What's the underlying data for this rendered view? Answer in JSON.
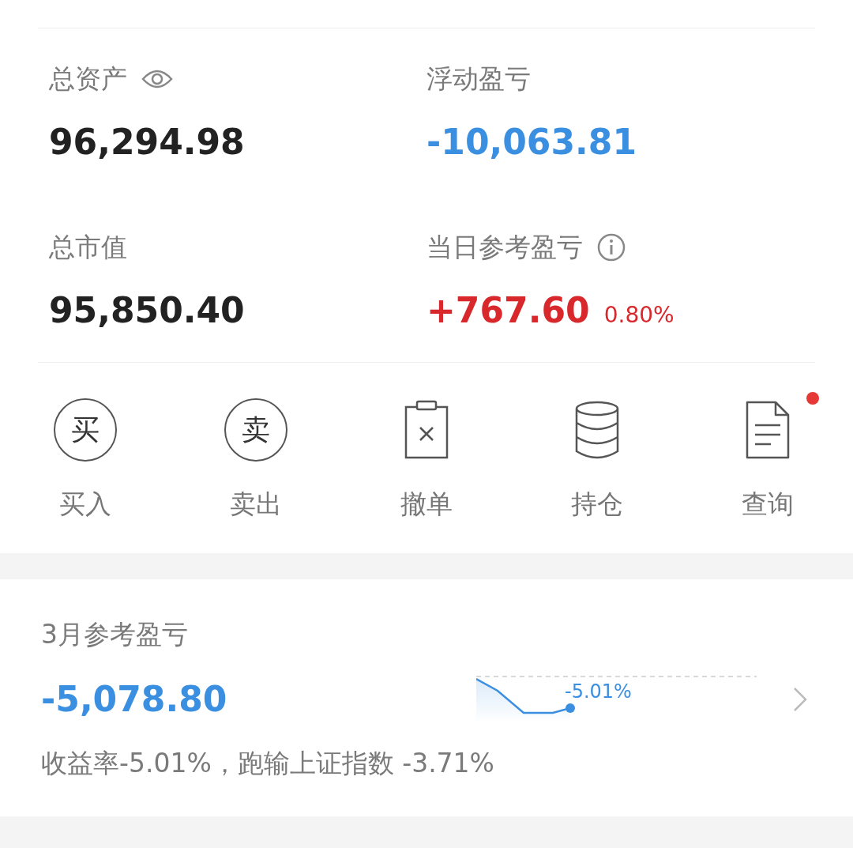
{
  "summary": [
    {
      "label": "总资产",
      "value": "96,294.98",
      "color": "#222222"
    },
    {
      "label": "浮动盈亏",
      "value": "-10,063.81",
      "color": "#3b8fe0"
    },
    {
      "label": "总市值",
      "value": "95,850.40",
      "color": "#222222"
    },
    {
      "label": "当日参考盈亏",
      "value": "+767.60",
      "color": "#d8282c",
      "percent": "0.80%"
    }
  ],
  "actions": [
    {
      "label": "买入",
      "kind": "circle-char",
      "icon_text": "买",
      "badge": false
    },
    {
      "label": "卖出",
      "kind": "circle-char",
      "icon_text": "卖",
      "badge": false
    },
    {
      "label": "撤单",
      "kind": "clipboard",
      "badge": false
    },
    {
      "label": "持仓",
      "kind": "database",
      "badge": false
    },
    {
      "label": "查询",
      "kind": "document",
      "badge": true
    }
  ],
  "month": {
    "label": "3月参考盈亏",
    "value": "-5,078.80",
    "color": "#3b8fe0",
    "sparkline_label": "-5.01%",
    "note": "收益率-5.01%，跑输上证指数 -3.71%"
  }
}
